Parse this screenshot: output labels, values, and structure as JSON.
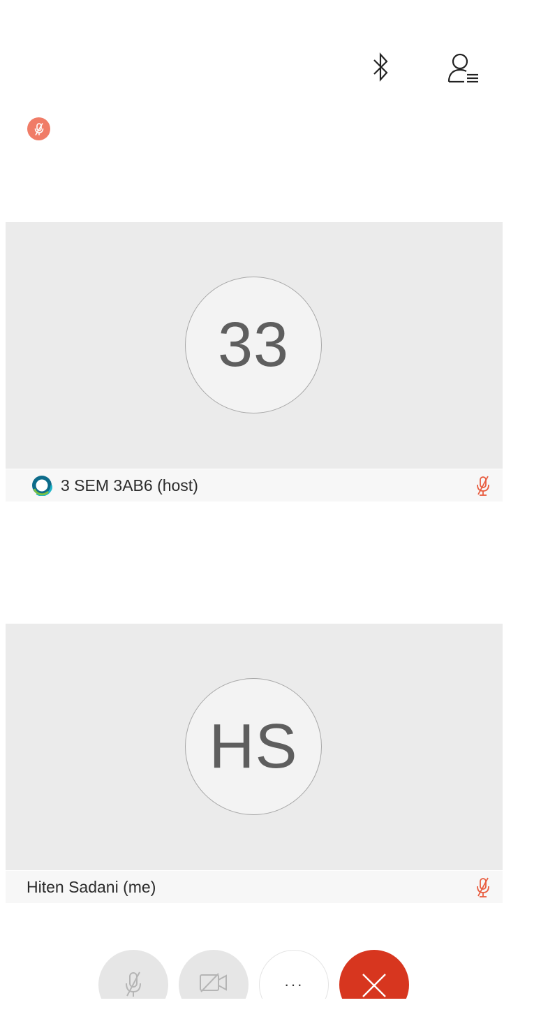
{
  "top_bar": {
    "bluetooth_icon": "bluetooth-icon",
    "participants_icon": "participants-list-icon"
  },
  "status": {
    "muted_icon": "mic-muted-icon",
    "muted_color": "#f07c67"
  },
  "participants": [
    {
      "avatar_initials": "33",
      "name": "3 SEM 3AB6 (host)",
      "has_host_logo": true,
      "mic_state": "muted"
    },
    {
      "avatar_initials": "HS",
      "name": "Hiten Sadani (me)",
      "has_host_logo": false,
      "mic_state": "muted"
    }
  ],
  "controls": {
    "mute_icon": "mic-muted-icon",
    "video_icon": "video-off-icon",
    "more_label": "···",
    "end_icon": "close-icon",
    "end_color": "#d7361f",
    "muted_accent": "#e85c3f"
  }
}
